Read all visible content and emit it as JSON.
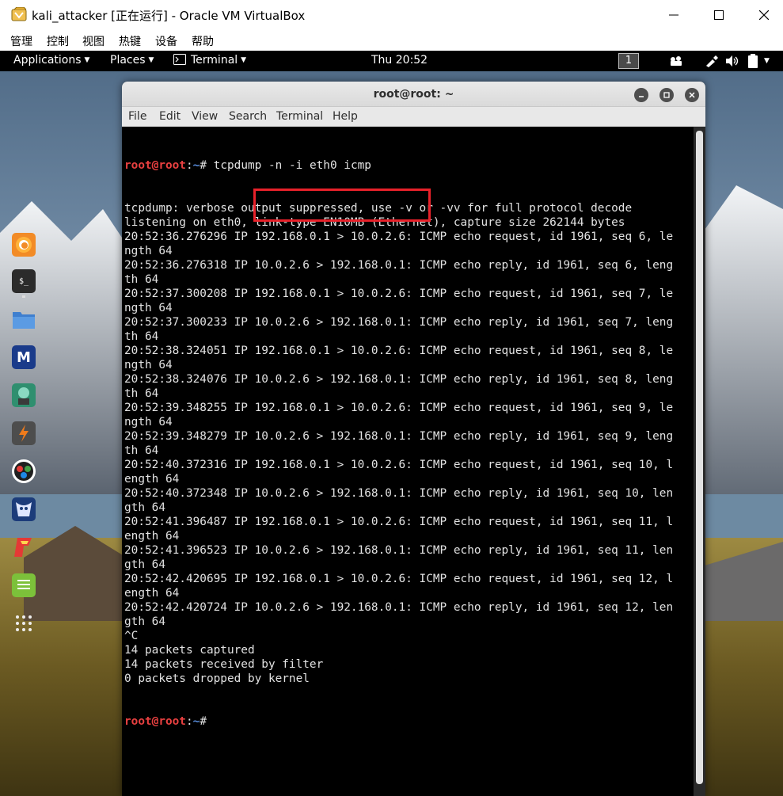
{
  "host_window": {
    "title": "kali_attacker [正在运行] - Oracle VM VirtualBox",
    "menu": [
      "管理",
      "控制",
      "视图",
      "热键",
      "设备",
      "帮助"
    ]
  },
  "gnome_panel": {
    "applications": "Applications",
    "places": "Places",
    "terminal": "Terminal",
    "clock": "Thu 20:52",
    "workspace": "1"
  },
  "dock": {
    "items": [
      "firefox-icon",
      "terminal-icon",
      "files-icon",
      "metasploit-icon",
      "armitage-icon",
      "burpsuite-icon",
      "faraday-icon",
      "beef-icon",
      "leafpad-icon",
      "text-editor-icon",
      "show-apps-icon"
    ]
  },
  "terminal": {
    "title": "root@root: ~",
    "menu": [
      "File",
      "Edit",
      "View",
      "Search",
      "Terminal",
      "Help"
    ],
    "prompt": {
      "user": "root@root",
      "sep": ":",
      "path": "~",
      "symbol": "#"
    },
    "command": " tcpdump -n -i eth0 icmp",
    "output": [
      "tcpdump: verbose output suppressed, use -v or -vv for full protocol decode",
      "listening on eth0, link-type EN10MB (Ethernet), capture size 262144 bytes",
      "20:52:36.276296 IP 192.168.0.1 > 10.0.2.6: ICMP echo request, id 1961, seq 6, le",
      "ngth 64",
      "20:52:36.276318 IP 10.0.2.6 > 192.168.0.1: ICMP echo reply, id 1961, seq 6, leng",
      "th 64",
      "20:52:37.300208 IP 192.168.0.1 > 10.0.2.6: ICMP echo request, id 1961, seq 7, le",
      "ngth 64",
      "20:52:37.300233 IP 10.0.2.6 > 192.168.0.1: ICMP echo reply, id 1961, seq 7, leng",
      "th 64",
      "20:52:38.324051 IP 192.168.0.1 > 10.0.2.6: ICMP echo request, id 1961, seq 8, le",
      "ngth 64",
      "20:52:38.324076 IP 10.0.2.6 > 192.168.0.1: ICMP echo reply, id 1961, seq 8, leng",
      "th 64",
      "20:52:39.348255 IP 192.168.0.1 > 10.0.2.6: ICMP echo request, id 1961, seq 9, le",
      "ngth 64",
      "20:52:39.348279 IP 10.0.2.6 > 192.168.0.1: ICMP echo reply, id 1961, seq 9, leng",
      "th 64",
      "20:52:40.372316 IP 192.168.0.1 > 10.0.2.6: ICMP echo request, id 1961, seq 10, l",
      "ength 64",
      "20:52:40.372348 IP 10.0.2.6 > 192.168.0.1: ICMP echo reply, id 1961, seq 10, len",
      "gth 64",
      "20:52:41.396487 IP 192.168.0.1 > 10.0.2.6: ICMP echo request, id 1961, seq 11, l",
      "ength 64",
      "20:52:41.396523 IP 10.0.2.6 > 192.168.0.1: ICMP echo reply, id 1961, seq 11, len",
      "gth 64",
      "20:52:42.420695 IP 192.168.0.1 > 10.0.2.6: ICMP echo request, id 1961, seq 12, l",
      "ength 64",
      "20:52:42.420724 IP 10.0.2.6 > 192.168.0.1: ICMP echo reply, id 1961, seq 12, len",
      "gth 64",
      "^C",
      "14 packets captured",
      "14 packets received by filter",
      "0 packets dropped by kernel"
    ]
  },
  "colors": {
    "prompt_user": "#e84040",
    "prompt_path": "#5a8fe0",
    "highlight": "#e8212a"
  }
}
